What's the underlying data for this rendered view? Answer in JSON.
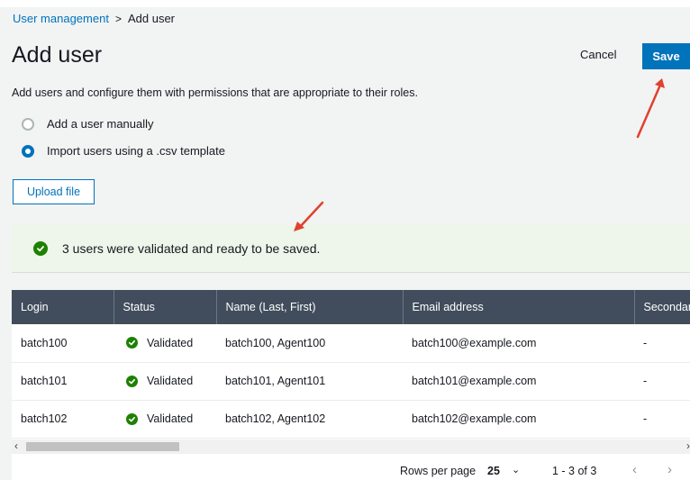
{
  "breadcrumb": {
    "parent": "User management",
    "separator": ">",
    "current": "Add user"
  },
  "header": {
    "title": "Add user",
    "cancel_label": "Cancel",
    "save_label": "Save"
  },
  "description": "Add users and configure them with permissions that are appropriate to their roles.",
  "options": [
    {
      "label": "Add a user manually",
      "selected": false
    },
    {
      "label": "Import users using a .csv template",
      "selected": true
    }
  ],
  "upload_label": "Upload file",
  "alert": {
    "text": "3 users were validated and ready to be saved.",
    "color": "#1d8102"
  },
  "table": {
    "columns": [
      "Login",
      "Status",
      "Name (Last, First)",
      "Email address",
      "Secondar"
    ],
    "rows": [
      {
        "login": "batch100",
        "status": "Validated",
        "name": "batch100, Agent100",
        "email": "batch100@example.com",
        "secondary": "-"
      },
      {
        "login": "batch101",
        "status": "Validated",
        "name": "batch101, Agent101",
        "email": "batch101@example.com",
        "secondary": "-"
      },
      {
        "login": "batch102",
        "status": "Validated",
        "name": "batch102, Agent102",
        "email": "batch102@example.com",
        "secondary": "-"
      }
    ]
  },
  "pagination": {
    "rows_per_page_label": "Rows per page",
    "rows_per_page": "25",
    "range": "1 - 3 of 3"
  },
  "colors": {
    "accent": "#0073bb",
    "header_bg": "#414d5c",
    "success": "#1d8102",
    "annotation": "#e0412e"
  }
}
